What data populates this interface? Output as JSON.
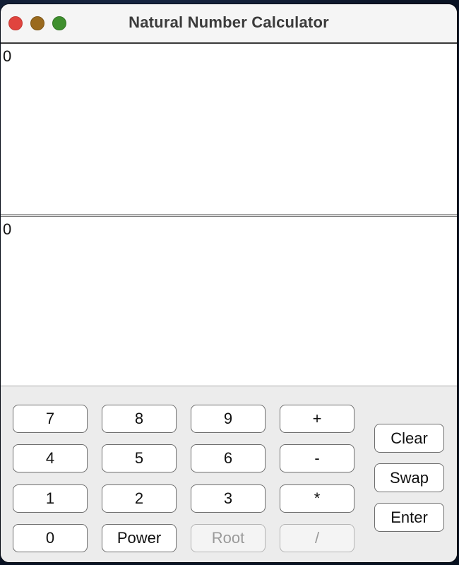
{
  "window": {
    "title": "Natural Number Calculator"
  },
  "display": {
    "top_value": "0",
    "bottom_value": "0"
  },
  "keypad": {
    "rows": [
      [
        "7",
        "8",
        "9",
        "+"
      ],
      [
        "4",
        "5",
        "6",
        "-"
      ],
      [
        "1",
        "2",
        "3",
        "*"
      ],
      [
        "0",
        "Power",
        "Root",
        "/"
      ]
    ],
    "side": [
      "Clear",
      "Swap",
      "Enter"
    ]
  },
  "colors": {
    "close": "#e0443e",
    "minimize": "#9a6a1e",
    "zoom": "#3f8f2e",
    "disabled_text": "#9a9a9a"
  }
}
